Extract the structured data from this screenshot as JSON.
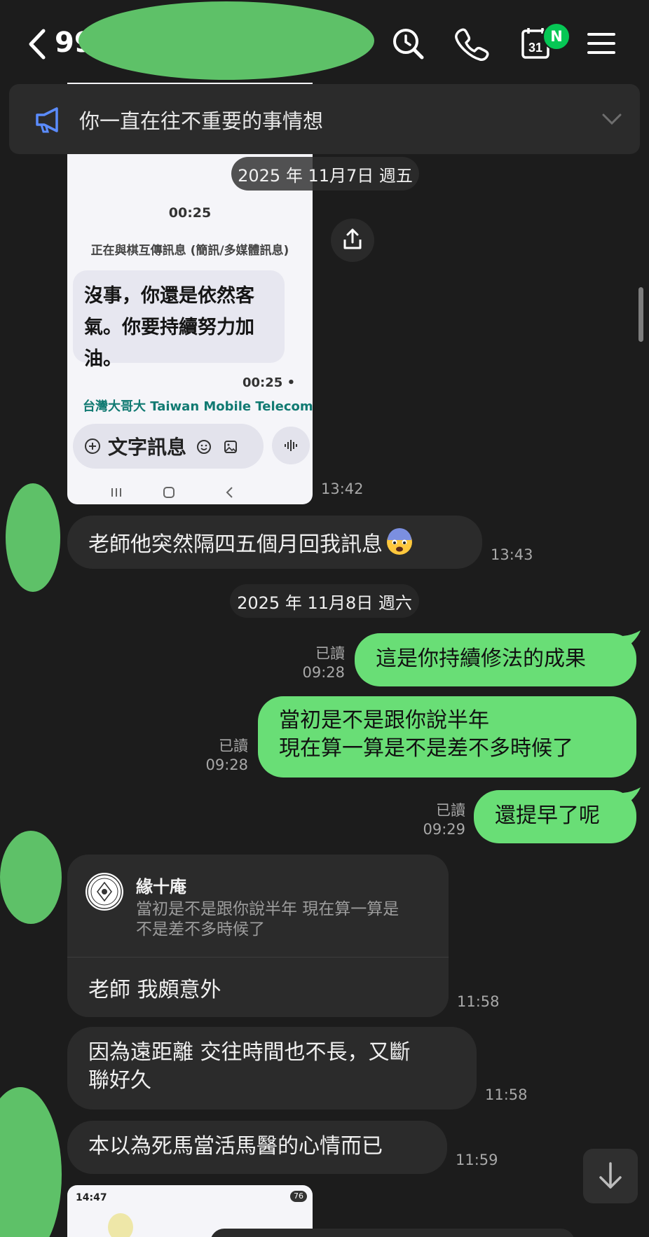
{
  "header": {
    "title": "99",
    "calendar_day": "31",
    "calendar_badge": "N"
  },
  "announcement": {
    "text": "你一直在往不重要的事情想"
  },
  "dates": {
    "first": "2025 年 11月7日 週五",
    "second": "2025 年 11月8日 週六"
  },
  "embedded_screenshot": {
    "time": "00:25",
    "conversation_info": "正在與棋互傳訊息 (簡訊/多媒體訊息)",
    "message_lines": [
      "沒事，你還是依然客",
      "氣。你要持續努力加",
      "油。"
    ],
    "message_time": "00:25 •",
    "carrier": "台灣大哥大 Taiwan Mobile Telecom",
    "input_placeholder": "文字訊息",
    "sent_time": "13:42"
  },
  "second_screenshot": {
    "status_time": "14:47",
    "battery": "76"
  },
  "messages": [
    {
      "side": "in",
      "lines": [
        "老師他突然隔四五個月回我訊息"
      ],
      "time": "13:43"
    },
    {
      "side": "out",
      "lines": [
        "這是你持續修法的成果"
      ],
      "read": "已讀",
      "time": "09:28"
    },
    {
      "side": "out",
      "lines": [
        "當初是不是跟你說半年",
        "現在算一算是不是差不多時候了"
      ],
      "read": "已讀",
      "time": "09:28"
    },
    {
      "side": "out",
      "lines": [
        "還提早了呢"
      ],
      "read": "已讀",
      "time": "09:29"
    },
    {
      "side": "in",
      "lines": [
        "因為遠距離 交往時間也不長，又斷",
        "聯好久"
      ],
      "time": "11:58"
    },
    {
      "side": "in",
      "lines": [
        "本以為死馬當活馬醫的心情而已"
      ],
      "time": "11:59"
    }
  ],
  "reply_card": {
    "sender": "緣十庵",
    "quoted_lines": [
      "當初是不是跟你說半年 現在算一算是",
      "不是差不多時候了"
    ],
    "body": "老師 我頗意外",
    "time": "11:58"
  },
  "colors": {
    "background": "#1c1c1c",
    "outgoing_bubble": "#69de76",
    "incoming_bubble": "#2b2b2b",
    "privacy_mask": "#5ec168",
    "badge": "#06c755"
  }
}
